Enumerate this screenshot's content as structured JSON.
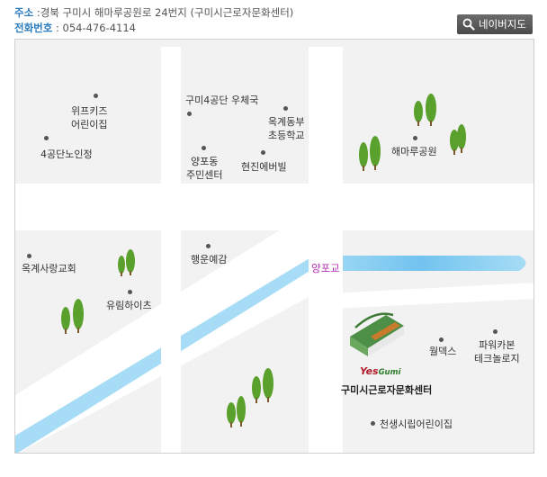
{
  "header": {
    "address_label": "주소",
    "address_value": ":경북 구미시 해마루공원로 24번지 (구미시근로자문화센터)",
    "phone_label": "전화번호",
    "phone_value": ":  054-476-4114",
    "naver_map_button": "네이버지도"
  },
  "map": {
    "bridge_label": "양포교",
    "center_logo_text": "es",
    "center_logo_sub": "Gumi",
    "center_name": "구미시근로자문화센터",
    "places": [
      {
        "name": "위프키즈\n어린이집"
      },
      {
        "name": "4공단노인정"
      },
      {
        "name": "구미4공단 우체국"
      },
      {
        "name": "옥계동부\n초등학교"
      },
      {
        "name": "양포동\n주민센터"
      },
      {
        "name": "현진에버빌"
      },
      {
        "name": "해마루공원"
      },
      {
        "name": "옥계사랑교회"
      },
      {
        "name": "행운예감"
      },
      {
        "name": "유림하이츠"
      },
      {
        "name": "월덱스"
      },
      {
        "name": "파워카본\n테크놀로지"
      },
      {
        "name": "천생시립어린이집"
      }
    ],
    "colors": {
      "road": "#ffffff",
      "river": "#a6dcf5",
      "tree": "#5aa02c",
      "background": "#f2f2f2"
    }
  }
}
